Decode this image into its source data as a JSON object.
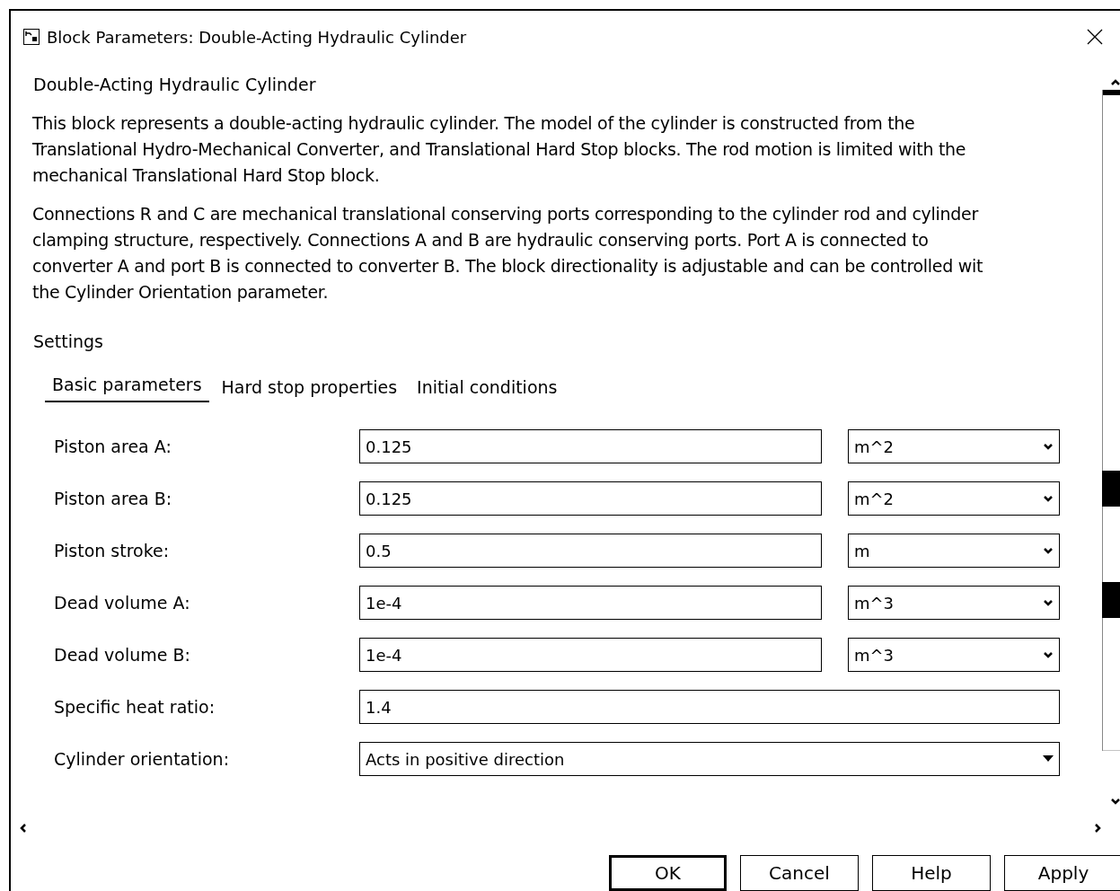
{
  "window": {
    "title": "Block Parameters: Double-Acting Hydraulic Cylinder"
  },
  "block_name": "Double-Acting Hydraulic Cylinder",
  "description": [
    [
      "This block represents a double-acting hydraulic cylinder. The model of the cylinder is constructed from the",
      "Translational Hydro-Mechanical Converter, and Translational Hard Stop blocks. The rod motion is limited with the",
      "mechanical Translational Hard Stop block."
    ],
    [
      "Connections R and C are mechanical translational conserving ports corresponding to the cylinder rod and cylinder",
      "clamping structure, respectively. Connections A and B are hydraulic conserving ports. Port A is connected to",
      "converter A and port B is connected to converter B. The block directionality is adjustable and can be controlled wit",
      "the Cylinder Orientation parameter."
    ]
  ],
  "settings_label": "Settings",
  "tabs": [
    {
      "label": "Basic parameters",
      "selected": true
    },
    {
      "label": "Hard stop properties",
      "selected": false
    },
    {
      "label": "Initial conditions",
      "selected": false
    }
  ],
  "parameters": [
    {
      "kind": "unit",
      "label": "Piston area A:",
      "value": "0.125",
      "unit": "m^2"
    },
    {
      "kind": "unit",
      "label": "Piston area B:",
      "value": "0.125",
      "unit": "m^2"
    },
    {
      "kind": "unit",
      "label": "Piston stroke:",
      "value": "0.5",
      "unit": "m"
    },
    {
      "kind": "unit",
      "label": "Dead volume A:",
      "value": "1e-4",
      "unit": "m^3"
    },
    {
      "kind": "unit",
      "label": "Dead volume B:",
      "value": "1e-4",
      "unit": "m^3"
    },
    {
      "kind": "plain",
      "label": "Specific heat ratio:",
      "value": "1.4"
    },
    {
      "kind": "dropdown",
      "label": "Cylinder orientation:",
      "value": "Acts in positive direction"
    }
  ],
  "buttons": [
    {
      "label": "OK",
      "default": true
    },
    {
      "label": "Cancel",
      "default": false
    },
    {
      "label": "Help",
      "default": false
    },
    {
      "label": "Apply",
      "default": false
    }
  ]
}
